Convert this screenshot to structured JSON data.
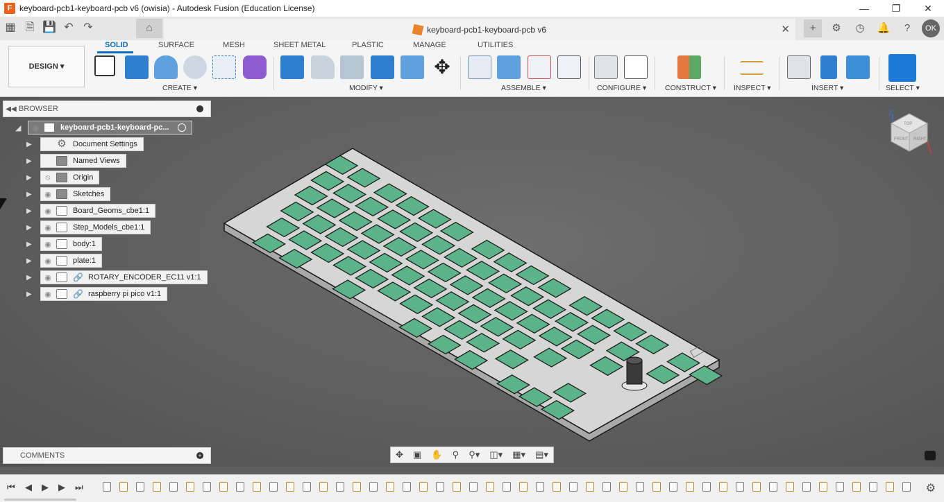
{
  "window": {
    "title": "keyboard-pcb1-keyboard-pcb v6 (owisia) - Autodesk Fusion (Education License)",
    "app_icon": "F",
    "controls": [
      "minimize-icon",
      "maximize-icon",
      "close-icon"
    ]
  },
  "document_tab": {
    "name": "keyboard-pcb1-keyboard-pcb v6"
  },
  "account": {
    "initials": "OK"
  },
  "workspace": {
    "label": "DESIGN ▾"
  },
  "ribbon": {
    "tabs": [
      "SOLID",
      "SURFACE",
      "MESH",
      "SHEET METAL",
      "PLASTIC",
      "MANAGE",
      "UTILITIES"
    ],
    "active_tab": "SOLID",
    "groups": [
      "CREATE ▾",
      "MODIFY ▾",
      "ASSEMBLE ▾",
      "CONFIGURE ▾",
      "CONSTRUCT ▾",
      "INSPECT ▾",
      "INSERT ▾",
      "SELECT ▾"
    ]
  },
  "browser": {
    "title": "BROWSER",
    "root": "keyboard-pcb1-keyboard-pc...",
    "items": [
      {
        "label": "Document Settings",
        "icon": "gear-icon"
      },
      {
        "label": "Named Views",
        "icon": "folder-icon"
      },
      {
        "label": "Origin",
        "icon": "folder-icon",
        "hidden": true
      },
      {
        "label": "Sketches",
        "icon": "folder-icon"
      },
      {
        "label": "Board_Geoms_cbe1:1",
        "icon": "component-icon"
      },
      {
        "label": "Step_Models_cbe1:1",
        "icon": "component-icon"
      },
      {
        "label": "body:1",
        "icon": "component-icon"
      },
      {
        "label": "plate:1",
        "icon": "component-icon"
      },
      {
        "label": "ROTARY_ENCODER_EC11 v1:1",
        "icon": "linked-component-icon"
      },
      {
        "label": "raspberry pi pico v1:1",
        "icon": "linked-component-icon"
      }
    ]
  },
  "comments": {
    "title": "COMMENTS"
  },
  "viewcube": {
    "faces": [
      "TOP",
      "FRONT",
      "RIGHT"
    ],
    "axis_label": "Z"
  },
  "colors": {
    "accent": "#0b6fc2",
    "plate": "#d9d9d9",
    "key_cutout": "#5cb38a",
    "viewport": "#5f5f5f"
  }
}
